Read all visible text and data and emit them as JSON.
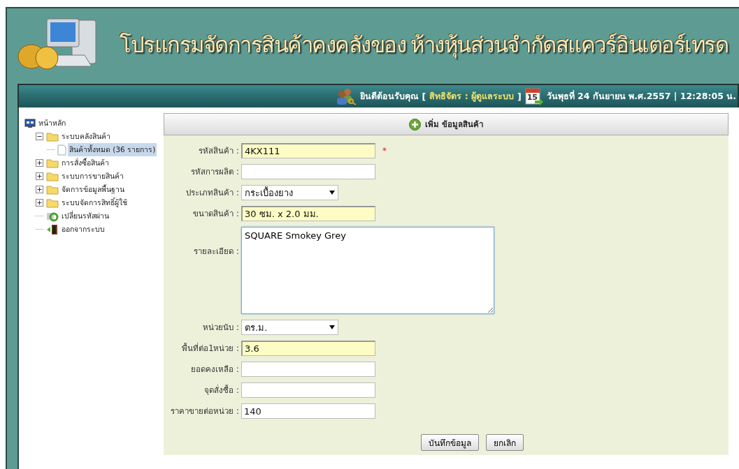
{
  "header": {
    "title": "โปรแกรมจัดการสินค้าคงคลังของ ห้างหุ้นส่วนจำกัดสแควร์อินเตอร์เทรด"
  },
  "user_bar": {
    "welcome": "ยินดีต้อนรับคุณ",
    "role_open": "[",
    "role": "สิทธิจัดร : ผู้ดูแลระบบ",
    "role_close": "]",
    "calendar_day": "15",
    "datetime": "วันพุธที่ 24 กันยายน พ.ศ.2557 | 12:28:05 น."
  },
  "sidebar": {
    "items": [
      {
        "label": "หน้าหลัก",
        "kind": "home",
        "selected": false,
        "children": [
          {
            "label": "ระบบคลังสินค้า",
            "kind": "folder",
            "expanded": true,
            "selected": false,
            "children": [
              {
                "label": "สินค้าทั้งหมด (36 รายการ)",
                "kind": "page",
                "selected": true
              }
            ]
          },
          {
            "label": "การสั่งซื้อสินค้า",
            "kind": "folder",
            "expanded": false,
            "selected": false
          },
          {
            "label": "ระบบการขายสินค้า",
            "kind": "folder",
            "expanded": false,
            "selected": false
          },
          {
            "label": "จัดการข้อมูลพื้นฐาน",
            "kind": "folder",
            "expanded": false,
            "selected": false
          },
          {
            "label": "ระบบจัดการสิทธิ์ผู้ใช้",
            "kind": "folder",
            "expanded": false,
            "selected": false
          },
          {
            "label": "เปลี่ยนรหัสผ่าน",
            "kind": "password",
            "selected": false
          },
          {
            "label": "ออกจากระบบ",
            "kind": "logout",
            "selected": false
          }
        ]
      }
    ]
  },
  "form": {
    "title": "เพิ่ม ข้อมูลสินค้า",
    "fields": [
      {
        "label": "รหัสสินค้า :",
        "kind": "text",
        "value": "4KX111",
        "highlighted": true,
        "required_mark": "*"
      },
      {
        "label": "รหัสการผลิต :",
        "kind": "text",
        "highlighted": false
      },
      {
        "label": "ประเภทสินค้า :",
        "kind": "select",
        "value": "กระเบื้องยาง",
        "highlighted": false
      },
      {
        "label": "ขนาดสินค้า :",
        "kind": "text",
        "value": "30 ซม. x 2.0 มม.",
        "highlighted": true
      },
      {
        "label": "รายละเอียด :",
        "kind": "textarea",
        "value": "SQUARE Smokey Grey",
        "highlighted": false
      },
      {
        "label": "หน่วยนับ :",
        "kind": "select",
        "value": "ตร.ม.",
        "highlighted": false
      },
      {
        "label": "พื้นที่ต่อ1หน่วย :",
        "kind": "text",
        "value": "3.6",
        "highlighted": true
      },
      {
        "label": "ยอดคงเหลือ :",
        "kind": "text",
        "highlighted": false
      },
      {
        "label": "จุดสั่งซื้อ :",
        "kind": "text",
        "highlighted": false
      },
      {
        "label": "ราคาขายต่อหน่วย :",
        "kind": "text",
        "value": "140",
        "highlighted": false
      }
    ],
    "buttons": [
      "บันทึกข้อมูล",
      "ยกเลิก"
    ]
  }
}
